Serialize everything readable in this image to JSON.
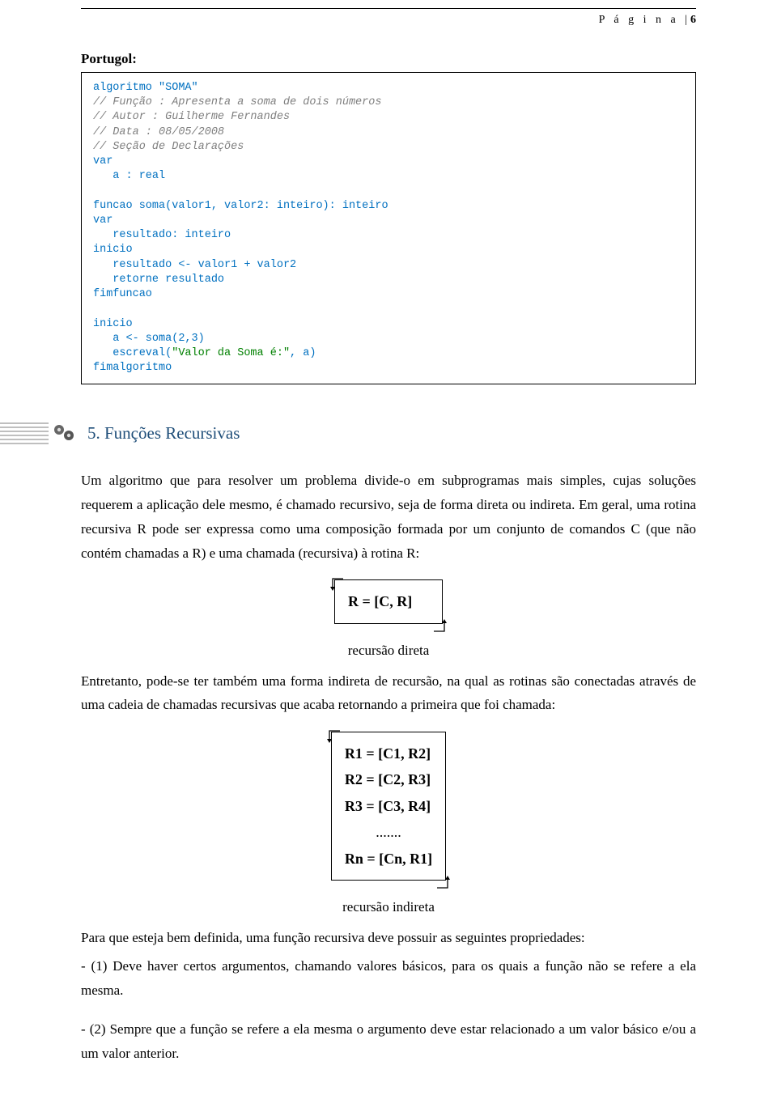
{
  "header": {
    "page_label": "P á g i n a",
    "page_separator": "|",
    "page_number": "6"
  },
  "portugol": {
    "label": "Portugol:",
    "code": {
      "l1": "algoritmo \"SOMA\"",
      "l2": "// Função : Apresenta a soma de dois números",
      "l3": "// Autor : Guilherme Fernandes",
      "l4": "// Data : 08/05/2008",
      "l5": "// Seção de Declarações",
      "l6": "var",
      "l7": "   a : real",
      "l8": "",
      "l9": "funcao soma(valor1, valor2: inteiro): inteiro",
      "l10": "var",
      "l11": "   resultado: inteiro",
      "l12": "inicio",
      "l13": "   resultado <- valor1 + valor2",
      "l14": "   retorne resultado",
      "l15": "fimfuncao",
      "l16": "",
      "l17": "inicio",
      "l18": "   a <- soma(2,3)",
      "l19a": "   escreval(",
      "l19b": "\"Valor da Soma é:\"",
      "l19c": ", a)",
      "l20": "fimalgoritmo"
    }
  },
  "section": {
    "title": "5. Funções Recursivas"
  },
  "body": {
    "p1": "Um algoritmo que para resolver um problema divide-o em subprogramas mais simples, cujas soluções requerem a aplicação dele mesmo, é chamado recursivo, seja de forma direta ou indireta. Em geral, uma rotina recursiva R pode ser expressa como uma composição formada por um conjunto de comandos C (que não contém chamadas a R) e uma chamada (recursiva) à rotina R:",
    "formula1": "R = [C, R]",
    "caption1": "recursão direta",
    "p2": "Entretanto, pode-se ter também uma forma indireta de recursão, na qual as rotinas são conectadas através de uma cadeia de chamadas recursivas que acaba retornando a primeira que foi chamada:",
    "formula2": {
      "r1": "R1 = [C1, R2]",
      "r2": "R2 = [C2, R3]",
      "r3": "R3 = [C3, R4]",
      "dots": ".......",
      "rn": "Rn = [Cn, R1]"
    },
    "caption2": "recursão indireta",
    "p3": "Para que esteja bem definida, uma função recursiva deve possuir as seguintes propriedades:",
    "li1": "- (1) Deve haver certos argumentos, chamando valores básicos, para os quais a função não se refere a ela mesma.",
    "li2": "- (2) Sempre que a função se refere a ela mesma o argumento deve estar relacionado a um valor básico e/ou a um valor anterior."
  }
}
